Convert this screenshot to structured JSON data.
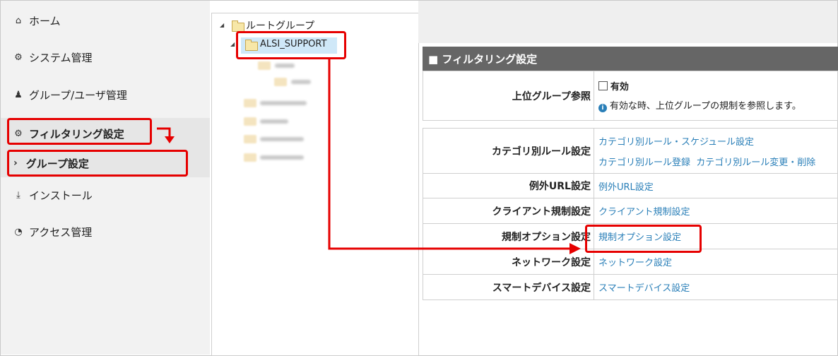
{
  "sidebar": {
    "items": [
      {
        "label": "ホーム",
        "icon": "home-icon"
      },
      {
        "label": "システム管理",
        "icon": "gear-icon"
      },
      {
        "label": "グループ/ユーザ管理",
        "icon": "users-icon"
      },
      {
        "label": "フィルタリング設定",
        "icon": "cogs-icon"
      },
      {
        "label": "グループ設定",
        "icon": "chevron-right-icon"
      },
      {
        "label": "インストール",
        "icon": "download-icon"
      },
      {
        "label": "アクセス管理",
        "icon": "pie-chart-icon"
      }
    ]
  },
  "tree": {
    "root": "ルートグループ",
    "selected": "ALSI_SUPPORT"
  },
  "filtering": {
    "title": "■ フィルタリング設定",
    "parent_ref": {
      "label": "上位グループ参照",
      "checkbox_label": "有効",
      "info": "有効な時、上位グループの規制を参照します。"
    },
    "rows": [
      {
        "label": "カテゴリ別ルール設定",
        "links": [
          "カテゴリ別ルール・スケジュール設定",
          "カテゴリ別ルール登録",
          "カテゴリ別ルール変更・削除"
        ]
      },
      {
        "label": "例外URL設定",
        "links": [
          "例外URL設定"
        ]
      },
      {
        "label": "クライアント規制設定",
        "links": [
          "クライアント規制設定"
        ]
      },
      {
        "label": "規制オプション設定",
        "links": [
          "規制オプション設定"
        ]
      },
      {
        "label": "ネットワーク設定",
        "links": [
          "ネットワーク設定"
        ]
      },
      {
        "label": "スマートデバイス設定",
        "links": [
          "スマートデバイス設定"
        ]
      }
    ]
  },
  "colors": {
    "annotation": "#e60000",
    "link": "#2a7fb8",
    "header": "#666666"
  }
}
